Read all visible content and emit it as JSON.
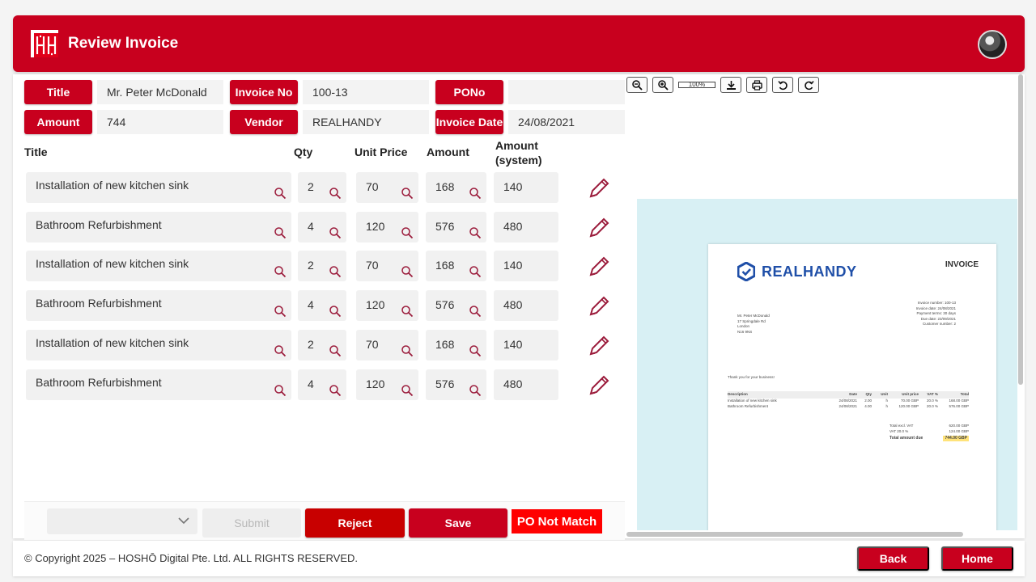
{
  "app": {
    "title": "Review Invoice"
  },
  "info": {
    "title_label": "Title",
    "title_value": "Mr. Peter McDonald",
    "invoice_no_label": "Invoice No",
    "invoice_no_value": "100-13",
    "pono_label": "PONo",
    "pono_value": "",
    "amount_label": "Amount",
    "amount_value": "744",
    "vendor_label": "Vendor",
    "vendor_value": "REALHANDY",
    "invoice_date_label": "Invoice Date",
    "invoice_date_value": "24/08/2021"
  },
  "table": {
    "headers": {
      "title": "Title",
      "qty": "Qty",
      "unit_price": "Unit Price",
      "amount": "Amount",
      "amount_system": "Amount (system)"
    },
    "rows": [
      {
        "title": "Installation of new kitchen sink",
        "qty": "2",
        "unit_price": "70",
        "amount": "168",
        "amount_system": "140"
      },
      {
        "title": "Bathroom Refurbishment",
        "qty": "4",
        "unit_price": "120",
        "amount": "576",
        "amount_system": "480"
      },
      {
        "title": "Installation of new kitchen sink",
        "qty": "2",
        "unit_price": "70",
        "amount": "168",
        "amount_system": "140"
      },
      {
        "title": "Bathroom Refurbishment",
        "qty": "4",
        "unit_price": "120",
        "amount": "576",
        "amount_system": "480"
      },
      {
        "title": "Installation of new kitchen sink",
        "qty": "2",
        "unit_price": "70",
        "amount": "168",
        "amount_system": "140"
      },
      {
        "title": "Bathroom Refurbishment",
        "qty": "4",
        "unit_price": "120",
        "amount": "576",
        "amount_system": "480"
      }
    ]
  },
  "actions": {
    "select_value": "",
    "submit_label": "Submit",
    "reject_label": "Reject",
    "save_label": "Save",
    "status_badge": "PO Not Match"
  },
  "viewer": {
    "zoom_level": "100%",
    "doc": {
      "brand": "REALHANDY",
      "heading": "INVOICE",
      "meta": [
        "Invoice number: 100-13",
        "Invoice date: 24/08/2021",
        "Payment terms: 30 days",
        "Due date: 23/09/2021",
        "Customer number: 2"
      ],
      "address": [
        "Mr. Peter McDonald",
        "17 Springdale Rd",
        "London",
        "N16 9NS"
      ],
      "thanks": "Thank you for your business!",
      "columns": [
        "Description",
        "Date",
        "Qty",
        "Unit",
        "Unit price",
        "VAT %",
        "Total"
      ],
      "lines": [
        [
          "Installation of new kitchen sink",
          "24/08/2021",
          "2.00",
          "h",
          "70.00 GBP",
          "20.0 %",
          "168.00 GBP"
        ],
        [
          "Bathroom Refurbishment",
          "24/08/2021",
          "4.00",
          "h",
          "120.00 GBP",
          "20.0 %",
          "576.00 GBP"
        ]
      ],
      "total_excl_label": "Total excl. VAT",
      "total_excl": "620.00 GBP",
      "vat_label": "VAT 20.0 %",
      "vat": "124.00 GBP",
      "due_label": "Total amount due",
      "due": "744.00 GBP"
    }
  },
  "footer": {
    "copyright": "© Copyright 2025 – HOSHŌ Digital Pte. Ltd. ALL RIGHTS RESERVED.",
    "back_label": "Back",
    "home_label": "Home"
  },
  "colors": {
    "brand_red": "#c8001e",
    "badge_red": "#ff0000",
    "canvas_bg": "#d8f0f4",
    "doc_brand_blue": "#1f4fa8"
  }
}
